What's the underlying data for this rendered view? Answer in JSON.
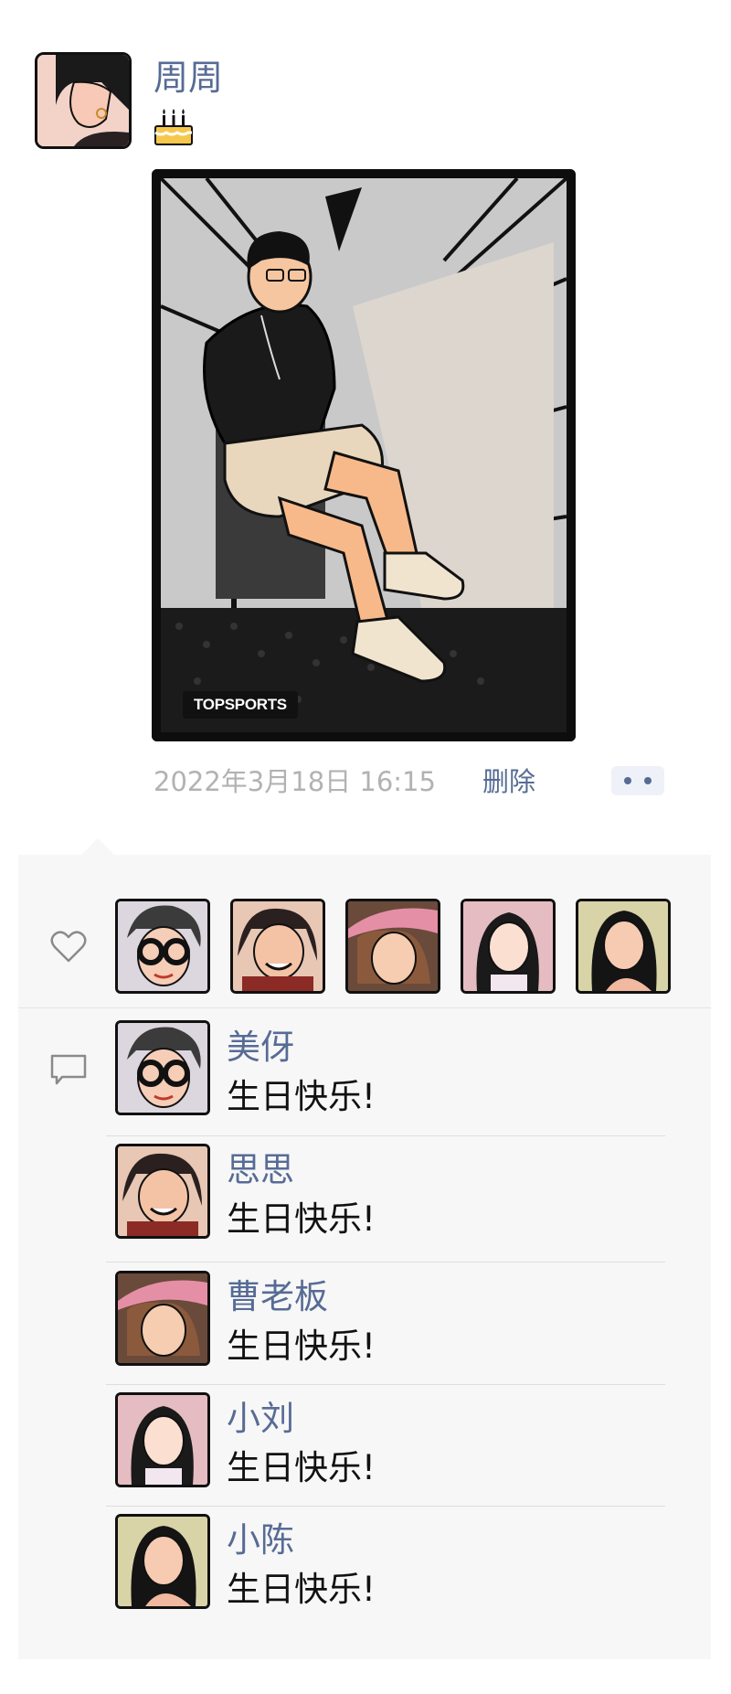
{
  "post": {
    "author_name": "周周",
    "author_avatar_icon": "illustrated-portrait-avatar",
    "badge_icon": "birthday-cake-icon",
    "image_brand": "TOPSPORTS",
    "timestamp": "2022年3月18日  16:15",
    "delete_label": "删除",
    "more_icon": "two-dot-more-icon"
  },
  "likes": {
    "icon": "heart-outline-icon",
    "avatars": [
      "美伢",
      "思思",
      "曹老板",
      "小刘",
      "小陈"
    ]
  },
  "comments": {
    "icon": "comment-bubble-icon",
    "items": [
      {
        "name": "美伢",
        "text": "生日快乐!"
      },
      {
        "name": "思思",
        "text": "生日快乐!"
      },
      {
        "name": "曹老板",
        "text": "生日快乐!"
      },
      {
        "name": "小刘",
        "text": "生日快乐!"
      },
      {
        "name": "小陈",
        "text": "生日快乐!"
      }
    ]
  },
  "colors": {
    "link_blue": "#576b95",
    "timestamp_gray": "#b2b2b2",
    "panel_background": "#f7f7f7"
  }
}
